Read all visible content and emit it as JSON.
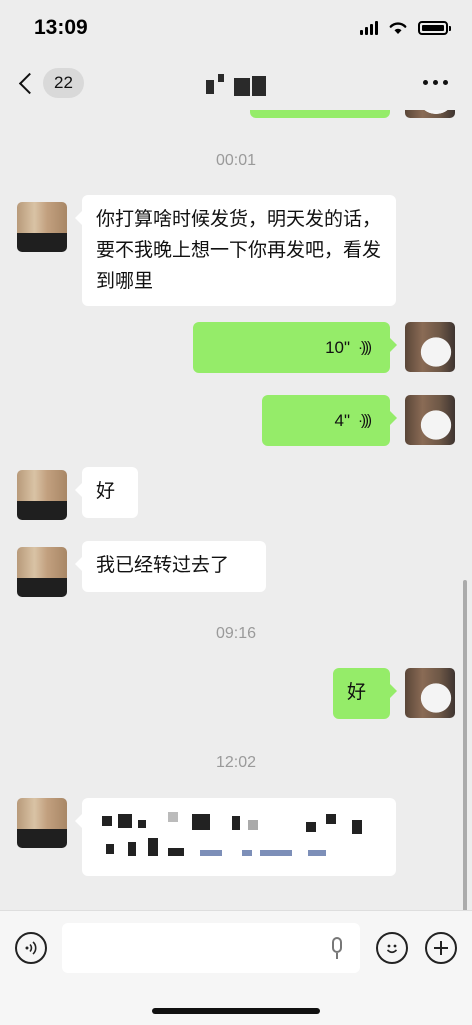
{
  "status_bar": {
    "time": "13:09"
  },
  "nav": {
    "unread_count": "22"
  },
  "messages": [
    {
      "type": "timestamp",
      "text": "00:01"
    },
    {
      "type": "text",
      "side": "left",
      "text": "你打算啥时候发货，明天发的话，要不我晚上想一下你再发吧，看发到哪里"
    },
    {
      "type": "voice",
      "side": "right",
      "duration": "10\""
    },
    {
      "type": "voice",
      "side": "right",
      "duration": "4\""
    },
    {
      "type": "text",
      "side": "left",
      "text": "好"
    },
    {
      "type": "text",
      "side": "left",
      "text": "我已经转过去了"
    },
    {
      "type": "timestamp",
      "text": "09:16"
    },
    {
      "type": "text",
      "side": "right",
      "text": "好"
    },
    {
      "type": "timestamp",
      "text": "12:02"
    },
    {
      "type": "text",
      "side": "left",
      "text": ""
    }
  ],
  "input_bar": {
    "voice_icon": "voice-toggle-icon",
    "mic_icon": "microphone-icon",
    "emoji_icon": "emoji-icon",
    "plus_icon": "plus-icon"
  },
  "colors": {
    "background": "#ededed",
    "outgoing_bubble": "#95ec69",
    "incoming_bubble": "#ffffff"
  }
}
